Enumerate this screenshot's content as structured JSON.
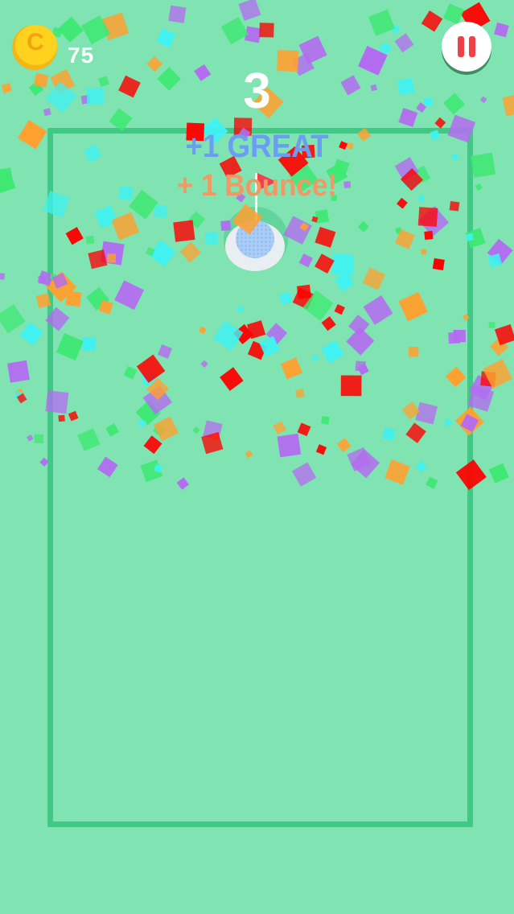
{
  "hud": {
    "coin_letter": "C",
    "coin_count": "75",
    "score": "3",
    "pause_icon": "pause-icon"
  },
  "feedback": {
    "great_text": "+1  GREAT",
    "bounce_text": "+ 1  Bounce!"
  },
  "colors": {
    "background": "#80e3b2",
    "court_border": "#3ec985",
    "coin": "#ffd21e",
    "pause_bars": "#f2404a",
    "great": "#6b9df2",
    "bounce": "#ef9a64",
    "flag": "#f3404f",
    "ball": "#aacdf6",
    "confetti": [
      "#ff0000",
      "#b36cf0",
      "#3ef2f2",
      "#ffa030",
      "#3ee873"
    ]
  }
}
